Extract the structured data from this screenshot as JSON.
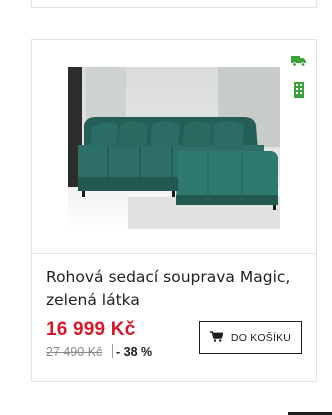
{
  "product": {
    "title": "Rohová sedací souprava Magic, zelená látka",
    "price": "16 999 Kč",
    "old_price": "27 490 Kč",
    "discount": "- 38 %",
    "image_icon": "green-corner-sofa-photo"
  },
  "badges": [
    {
      "icon": "delivery-truck-icon",
      "color": "#3aa23a"
    },
    {
      "icon": "stock-building-icon",
      "color": "#3aa23a"
    }
  ],
  "cart_button": {
    "label": "DO KOŠÍKU",
    "icon": "shopping-cart-icon"
  },
  "colors": {
    "price": "#d7182a",
    "badge_green": "#3aa23a",
    "sofa": "#2b6f66"
  }
}
